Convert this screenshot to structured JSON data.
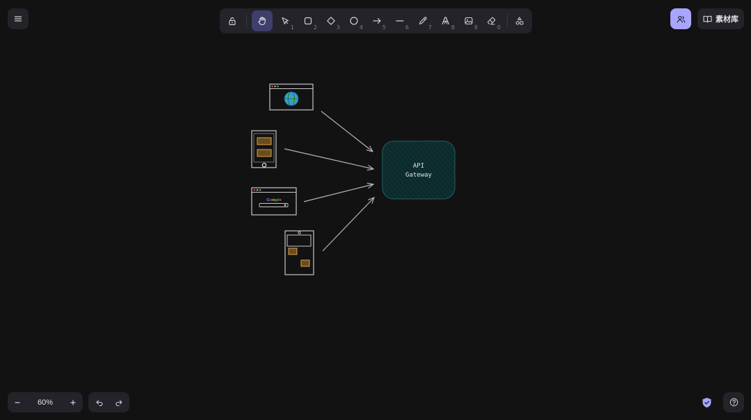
{
  "toolbar": {
    "tools": [
      {
        "name": "lock",
        "key": ""
      },
      {
        "name": "hand",
        "key": ""
      },
      {
        "name": "selection",
        "key": "1"
      },
      {
        "name": "rectangle",
        "key": "2"
      },
      {
        "name": "diamond",
        "key": "3"
      },
      {
        "name": "ellipse",
        "key": "4"
      },
      {
        "name": "arrow",
        "key": "5"
      },
      {
        "name": "line",
        "key": "6"
      },
      {
        "name": "draw",
        "key": "7"
      },
      {
        "name": "text",
        "key": "8"
      },
      {
        "name": "image",
        "key": "9"
      },
      {
        "name": "eraser",
        "key": "0"
      },
      {
        "name": "more-shapes",
        "key": ""
      }
    ],
    "active_tool": "hand"
  },
  "header": {
    "library_label": "素材库"
  },
  "canvas": {
    "gateway_line1": "API",
    "gateway_line2": "Gateway",
    "search_logo_text": "Google",
    "colors": {
      "gateway_fill": "#0c2a2a",
      "gateway_stroke": "#1f5555",
      "hatch": "#164040",
      "stroke": "#c7c7cc",
      "orange_fill": "#6b4d1c",
      "orange_stroke": "#d9a24e",
      "globe_blue": "#2f9fe0",
      "globe_green": "#47b04b"
    }
  },
  "footer": {
    "zoom_level": "60%"
  },
  "colors": {
    "background": "#121212",
    "panel": "#232329",
    "accent": "#a8a5ff",
    "active_tool_bg": "#403e6a"
  }
}
